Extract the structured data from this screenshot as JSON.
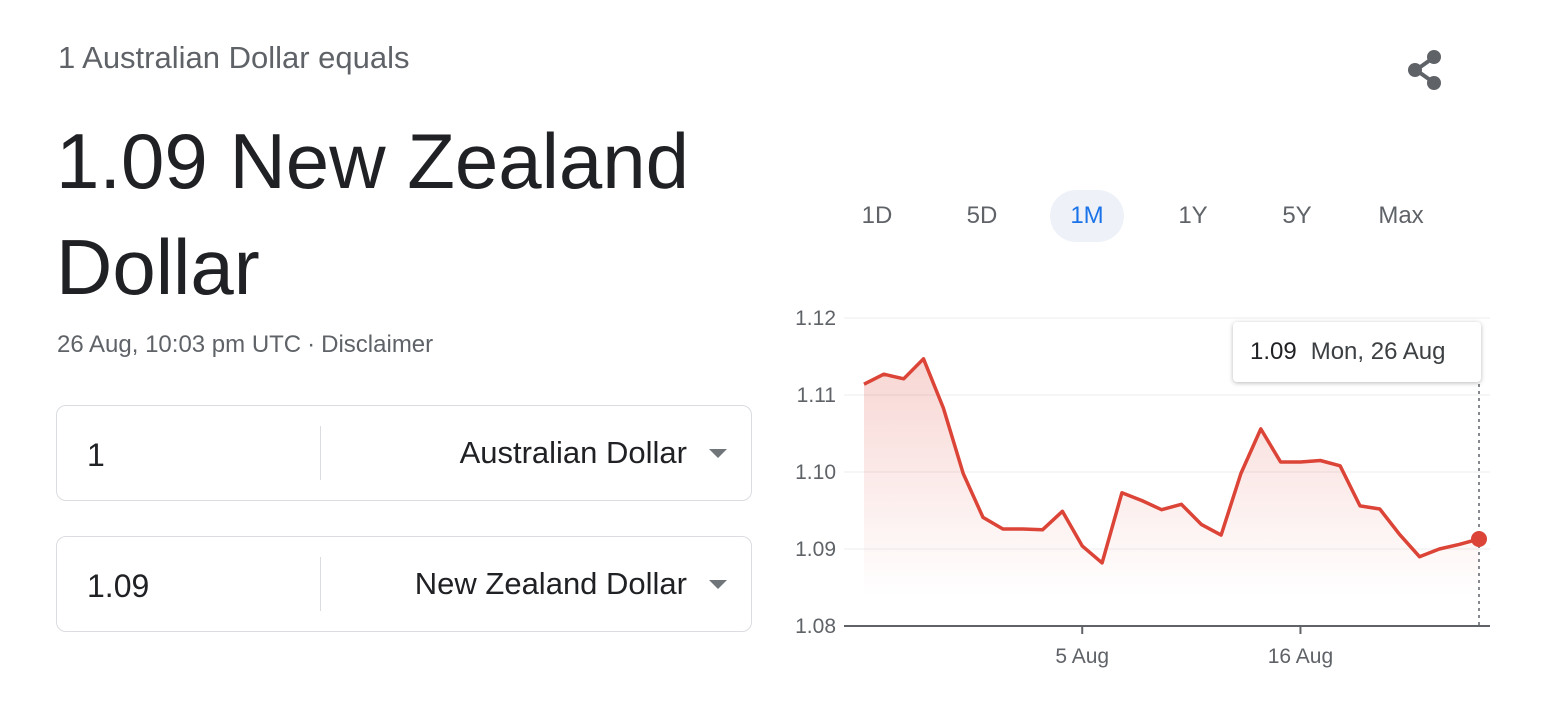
{
  "header": {
    "subtitle": "1 Australian Dollar equals",
    "headline": "1.09 New Zealand Dollar",
    "timestamp": "26 Aug, 10:03 pm UTC",
    "separator": "·",
    "disclaimer": "Disclaimer"
  },
  "converter": {
    "from": {
      "amount": "1",
      "currency": "Australian Dollar"
    },
    "to": {
      "amount": "1.09",
      "currency": "New Zealand Dollar"
    }
  },
  "share_icon": "share-icon",
  "range_tabs": [
    {
      "label": "1D",
      "active": false
    },
    {
      "label": "5D",
      "active": false
    },
    {
      "label": "1M",
      "active": true
    },
    {
      "label": "1Y",
      "active": false
    },
    {
      "label": "5Y",
      "active": false
    },
    {
      "label": "Max",
      "active": false
    }
  ],
  "tooltip": {
    "value": "1.09",
    "date": "Mon, 26 Aug"
  },
  "colors": {
    "line": "#db4437",
    "active_tab": "#1a73e8",
    "active_tab_bg": "#eef2f8"
  },
  "chart_data": {
    "type": "area",
    "title": "",
    "xlabel": "",
    "ylabel": "",
    "ylim": [
      1.08,
      1.12
    ],
    "y_ticks": [
      1.12,
      1.11,
      1.1,
      1.09,
      1.08
    ],
    "y_tick_labels": [
      "1.12",
      "1.11",
      "1.10",
      "1.09",
      "1.08"
    ],
    "x_ticks": [
      {
        "index": 11,
        "label": "5 Aug"
      },
      {
        "index": 22,
        "label": "16 Aug"
      }
    ],
    "grid": true,
    "series": [
      {
        "values": [
          1.1114,
          1.1127,
          1.1121,
          1.1147,
          1.1083,
          1.0998,
          1.0941,
          1.0926,
          1.0926,
          1.0925,
          1.0949,
          1.0904,
          1.0882,
          1.0973,
          1.0963,
          1.0951,
          1.0958,
          1.0932,
          1.0918,
          1.0998,
          1.1056,
          1.1013,
          1.1013,
          1.1015,
          1.1008,
          1.0956,
          1.0952,
          1.0919,
          1.089,
          1.09,
          1.0906,
          1.0913
        ]
      }
    ]
  }
}
